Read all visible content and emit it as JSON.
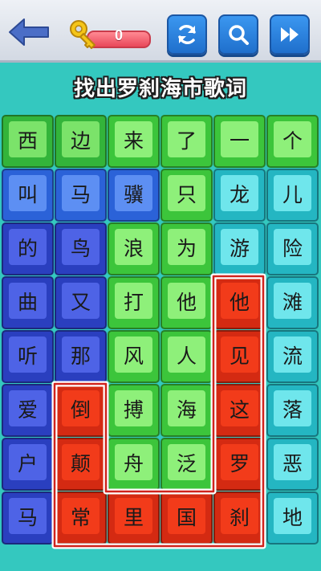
{
  "header": {
    "key_count": "0"
  },
  "title": "找出罗刹海市歌词",
  "grid": [
    [
      {
        "ch": "西",
        "color": "green"
      },
      {
        "ch": "边",
        "color": "green"
      },
      {
        "ch": "来",
        "color": "lgreen"
      },
      {
        "ch": "了",
        "color": "lgreen"
      },
      {
        "ch": "一",
        "color": "lgreen"
      },
      {
        "ch": "个",
        "color": "lgreen"
      }
    ],
    [
      {
        "ch": "叫",
        "color": "blue"
      },
      {
        "ch": "马",
        "color": "blue"
      },
      {
        "ch": "骥",
        "color": "blue"
      },
      {
        "ch": "只",
        "color": "lgreen"
      },
      {
        "ch": "龙",
        "color": "cyan"
      },
      {
        "ch": "儿",
        "color": "cyan"
      }
    ],
    [
      {
        "ch": "的",
        "color": "navy"
      },
      {
        "ch": "鸟",
        "color": "navy"
      },
      {
        "ch": "浪",
        "color": "lgreen"
      },
      {
        "ch": "为",
        "color": "lgreen"
      },
      {
        "ch": "游",
        "color": "cyan"
      },
      {
        "ch": "险",
        "color": "cyan"
      }
    ],
    [
      {
        "ch": "曲",
        "color": "navy"
      },
      {
        "ch": "又",
        "color": "navy"
      },
      {
        "ch": "打",
        "color": "lgreen"
      },
      {
        "ch": "他",
        "color": "lgreen"
      },
      {
        "ch": "他",
        "color": "red"
      },
      {
        "ch": "滩",
        "color": "cyan"
      }
    ],
    [
      {
        "ch": "听",
        "color": "navy"
      },
      {
        "ch": "那",
        "color": "navy"
      },
      {
        "ch": "风",
        "color": "lgreen"
      },
      {
        "ch": "人",
        "color": "lgreen"
      },
      {
        "ch": "见",
        "color": "red"
      },
      {
        "ch": "流",
        "color": "cyan"
      }
    ],
    [
      {
        "ch": "爱",
        "color": "navy"
      },
      {
        "ch": "倒",
        "color": "red"
      },
      {
        "ch": "搏",
        "color": "lgreen"
      },
      {
        "ch": "海",
        "color": "lgreen"
      },
      {
        "ch": "这",
        "color": "red"
      },
      {
        "ch": "落",
        "color": "cyan"
      }
    ],
    [
      {
        "ch": "户",
        "color": "navy"
      },
      {
        "ch": "颠",
        "color": "red"
      },
      {
        "ch": "舟",
        "color": "lgreen"
      },
      {
        "ch": "泛",
        "color": "lgreen"
      },
      {
        "ch": "罗",
        "color": "red"
      },
      {
        "ch": "恶",
        "color": "cyan"
      }
    ],
    [
      {
        "ch": "马",
        "color": "navy"
      },
      {
        "ch": "常",
        "color": "red"
      },
      {
        "ch": "里",
        "color": "red"
      },
      {
        "ch": "国",
        "color": "red"
      },
      {
        "ch": "刹",
        "color": "red"
      },
      {
        "ch": "地",
        "color": "cyan"
      }
    ]
  ],
  "colors": {
    "selection_outline": "#ffffff",
    "selection_stroke": "#d0231d"
  }
}
